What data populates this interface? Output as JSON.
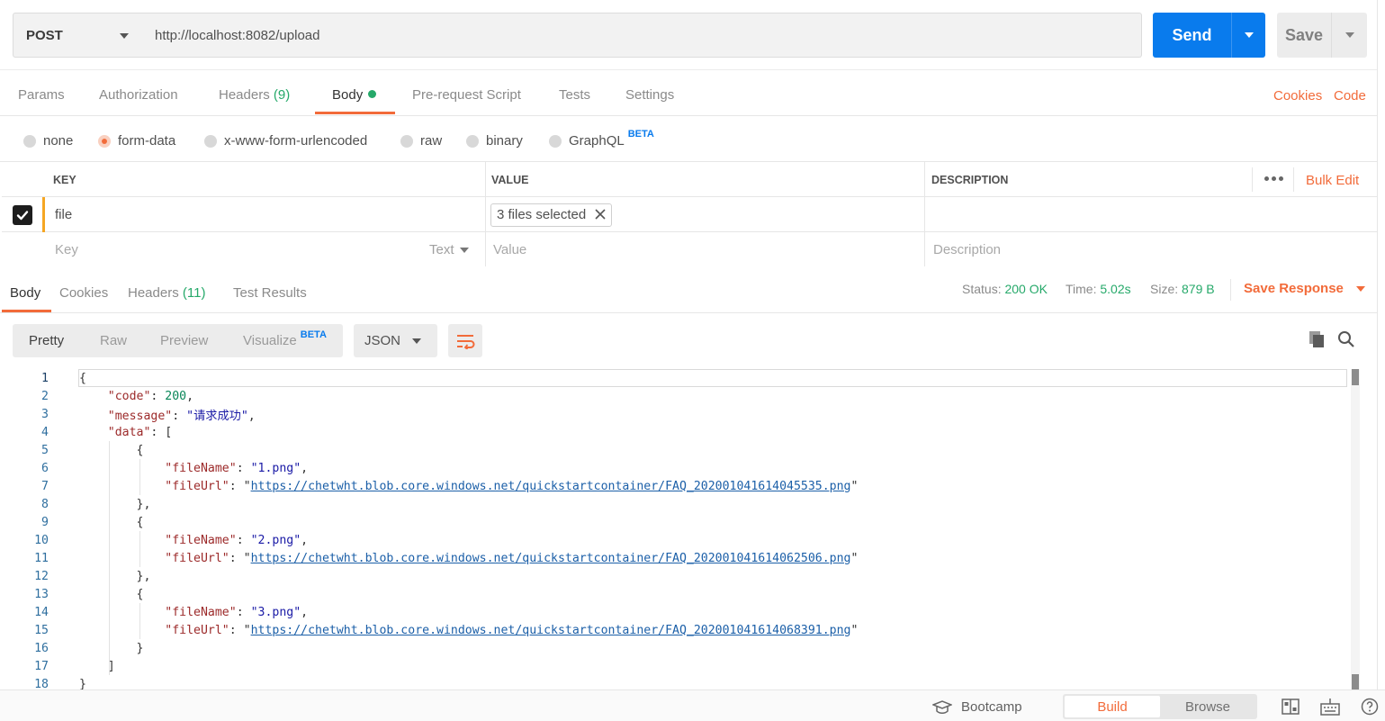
{
  "request": {
    "method": "POST",
    "url": "http://localhost:8082/upload",
    "send_label": "Send",
    "save_label": "Save"
  },
  "request_tabs": {
    "params": "Params",
    "authorization": "Authorization",
    "headers": "Headers",
    "headers_count": "(9)",
    "body": "Body",
    "prerequest": "Pre-request Script",
    "tests": "Tests",
    "settings": "Settings",
    "cookies": "Cookies",
    "code": "Code"
  },
  "body_types": {
    "none": "none",
    "form_data": "form-data",
    "urlencoded": "x-www-form-urlencoded",
    "raw": "raw",
    "binary": "binary",
    "graphql": "GraphQL",
    "graphql_badge": "BETA",
    "selected": "form-data"
  },
  "params_table": {
    "headers": {
      "key": "KEY",
      "value": "VALUE",
      "description": "DESCRIPTION"
    },
    "bulk_edit": "Bulk Edit",
    "rows": [
      {
        "key": "file",
        "value": "3 files selected",
        "checked": true
      }
    ],
    "placeholders": {
      "key": "Key",
      "type": "Text",
      "value": "Value",
      "description": "Description"
    }
  },
  "response_tabs": {
    "body": "Body",
    "cookies": "Cookies",
    "headers": "Headers",
    "headers_count": "(11)",
    "test_results": "Test Results"
  },
  "response_status": {
    "status_label": "Status:",
    "status_value": "200 OK",
    "time_label": "Time:",
    "time_value": "5.02s",
    "size_label": "Size:",
    "size_value": "879 B",
    "save_response": "Save Response"
  },
  "response_view": {
    "pretty": "Pretty",
    "raw": "Raw",
    "preview": "Preview",
    "visualize": "Visualize",
    "visualize_badge": "BETA",
    "format": "JSON"
  },
  "response_body_lines": [
    "{",
    "    \"code\": 200,",
    "    \"message\": \"请求成功\",",
    "    \"data\": [",
    "        {",
    "            \"fileName\": \"1.png\",",
    "            \"fileUrl\": \"https://chetwht.blob.core.windows.net/quickstartcontainer/FAQ_202001041614045535.png\"",
    "        },",
    "        {",
    "            \"fileName\": \"2.png\",",
    "            \"fileUrl\": \"https://chetwht.blob.core.windows.net/quickstartcontainer/FAQ_202001041614062506.png\"",
    "        },",
    "        {",
    "            \"fileName\": \"3.png\",",
    "            \"fileUrl\": \"https://chetwht.blob.core.windows.net/quickstartcontainer/FAQ_202001041614068391.png\"",
    "        }",
    "    ]",
    "}"
  ],
  "footer": {
    "bootcamp": "Bootcamp",
    "build": "Build",
    "browse": "Browse"
  },
  "colors": {
    "accent": "#f26b3a",
    "primary": "#097bed",
    "success": "#26a96a"
  },
  "icons": [
    "caret-down-icon",
    "checkbox-checked-icon",
    "close-icon",
    "more-icon",
    "wrap-lines-icon",
    "copy-icon",
    "search-icon",
    "bootcamp-icon",
    "two-pane-icon",
    "keyboard-icon",
    "help-icon"
  ]
}
